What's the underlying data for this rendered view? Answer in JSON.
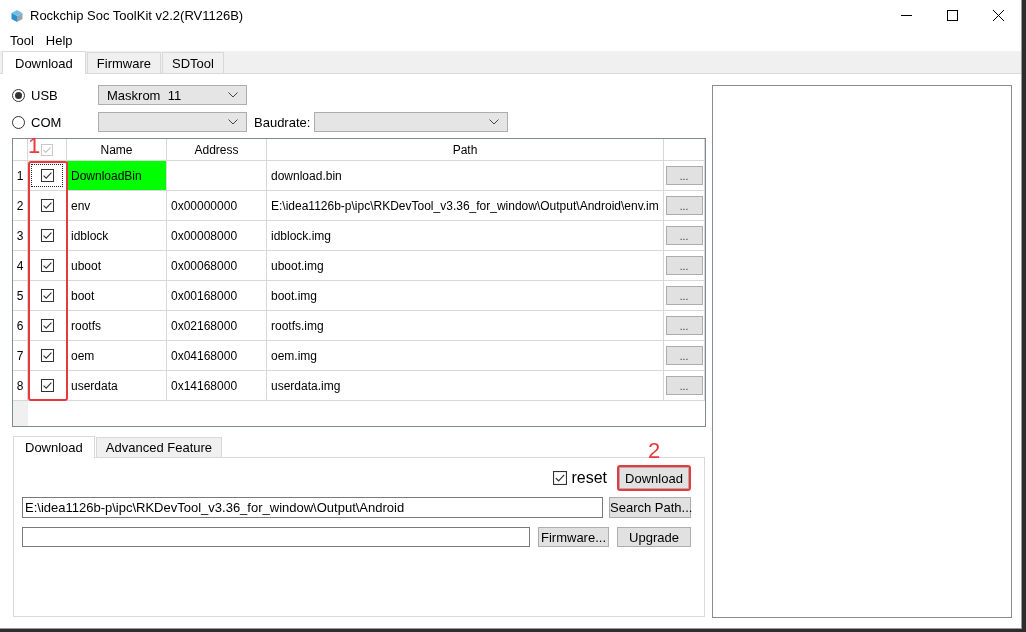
{
  "window": {
    "title": "Rockchip Soc ToolKit v2.2(RV1126B)"
  },
  "menu": [
    "Tool",
    "Help"
  ],
  "tabs": [
    {
      "label": "Download",
      "selected": true
    },
    {
      "label": "Firmware",
      "selected": false
    },
    {
      "label": "SDTool",
      "selected": false
    }
  ],
  "ports": [
    {
      "label": "USB",
      "selected": true,
      "device": "Maskrom  11"
    },
    {
      "label": "COM",
      "selected": false
    }
  ],
  "baudrate": {
    "label": "Baudrate:"
  },
  "table": {
    "callout": "1",
    "header_check": {
      "checked": true,
      "disabled": true
    },
    "columns": [
      "Name",
      "Address",
      "Path"
    ],
    "rows": [
      {
        "index": "1",
        "checked": true,
        "focused": true,
        "highlighted": true,
        "name": "DownloadBin",
        "path": "download.bin",
        "browse": "..."
      },
      {
        "index": "2",
        "checked": true,
        "focused": false,
        "highlighted": false,
        "name": "env",
        "address": "0x00000000",
        "path": "E:\\idea1126b-p\\ipc\\RKDevTool_v3.36_for_window\\Output\\Android\\env.im",
        "browse": "..."
      },
      {
        "index": "3",
        "checked": true,
        "focused": false,
        "highlighted": false,
        "name": "idblock",
        "address": "0x00008000",
        "path": "idblock.img",
        "browse": "..."
      },
      {
        "index": "4",
        "checked": true,
        "focused": false,
        "highlighted": false,
        "name": "uboot",
        "address": "0x00068000",
        "path": "uboot.img",
        "browse": "..."
      },
      {
        "index": "5",
        "checked": true,
        "focused": false,
        "highlighted": false,
        "name": "boot",
        "address": "0x00168000",
        "path": "boot.img",
        "browse": "..."
      },
      {
        "index": "6",
        "checked": true,
        "focused": false,
        "highlighted": false,
        "name": "rootfs",
        "address": "0x02168000",
        "path": "rootfs.img",
        "browse": "..."
      },
      {
        "index": "7",
        "checked": true,
        "focused": false,
        "highlighted": false,
        "name": "oem",
        "address": "0x04168000",
        "path": "oem.img",
        "browse": "..."
      },
      {
        "index": "8",
        "checked": true,
        "focused": false,
        "highlighted": false,
        "name": "userdata",
        "address": "0x14168000",
        "path": "userdata.img",
        "browse": "..."
      }
    ]
  },
  "lower_tabs": [
    {
      "label": "Download",
      "selected": true
    },
    {
      "label": "Advanced Feature",
      "selected": false
    }
  ],
  "reset": {
    "label": "reset",
    "checked": true
  },
  "download_button": {
    "label": "Download",
    "callout": "2"
  },
  "path_field": {
    "value": "E:\\idea1126b-p\\ipc\\RKDevTool_v3.36_for_window\\Output\\Android"
  },
  "search_button": "Search Path...",
  "firmware_button": "Firmware...",
  "upgrade_button": "Upgrade"
}
